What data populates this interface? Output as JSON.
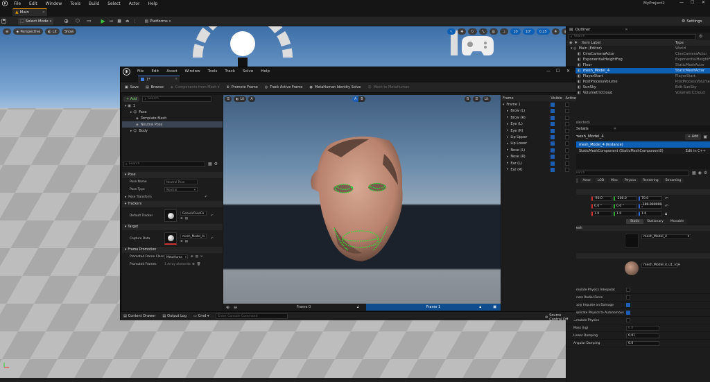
{
  "ue": {
    "menu": {
      "items": [
        "File",
        "Edit",
        "Window",
        "Tools",
        "Build",
        "Select",
        "Actor",
        "Help"
      ]
    },
    "project": "MyProject2",
    "main_tab": "Main",
    "toolbar": {
      "mode": "Select Mode",
      "platforms": "Platforms",
      "settings": "Settings"
    },
    "viewport": {
      "perspective": "Perspective",
      "lit": "Lit",
      "show": "Show",
      "fov": "10°",
      "scale": "0.25",
      "cam": "4",
      "grid": "10"
    }
  },
  "outliner": {
    "title": "Outliner",
    "search_placeholder": "Search",
    "col_label": "Item Label",
    "col_type": "Type",
    "rows": [
      {
        "label": "Main (Editor)",
        "type": "World",
        "indent": 0
      },
      {
        "label": "CineCameraActor",
        "type": "CineCameraActor",
        "indent": 1
      },
      {
        "label": "ExponentialHeightFog",
        "type": "ExponentialHeightFog",
        "indent": 1
      },
      {
        "label": "Floor",
        "type": "StaticMeshActor",
        "indent": 1
      },
      {
        "label": "mesh_Model_4",
        "type": "StaticMeshActor",
        "indent": 1,
        "selected": true
      },
      {
        "label": "PlayerStart",
        "type": "PlayerStart",
        "indent": 1
      },
      {
        "label": "PostProcessVolume",
        "type": "PostProcessVolume",
        "indent": 1
      },
      {
        "label": "SunSky",
        "type": "Edit SunSky",
        "indent": 1
      },
      {
        "label": "VolumetricCloud",
        "type": "VolumetricCloud",
        "indent": 1
      }
    ],
    "status": "(1 selected)"
  },
  "details": {
    "title": "Details",
    "actor": "mesh_Model_4",
    "add": "+ Add",
    "instance": "mesh_Model_4 (Instance)",
    "component": "StaticMeshComponent (StaticMeshComponent0)",
    "edit_in": "Edit in C++",
    "search_placeholder": "Search",
    "tabs": [
      "All",
      "Actor",
      "LOD",
      "Misc",
      "Physics",
      "Rendering",
      "Streaming"
    ],
    "loc": [
      "-90.0",
      "-200.0",
      "70.0"
    ],
    "rot": [
      "0.0 °",
      "0.0 °",
      "-189.999999 °"
    ],
    "scale": [
      "1.0",
      "1.0",
      "1.0"
    ],
    "mobility": [
      "Static",
      "Stationary",
      "Movable"
    ],
    "mesh_label": "Mesh",
    "mesh_value": "mesh_Model_4",
    "material_value": "mesh_Model_4_u1_v1",
    "props": [
      {
        "label": "Simulate Physics Interpolat",
        "type": "check",
        "on": false
      },
      {
        "label": "Ignore Radial Force",
        "type": "check",
        "on": false
      },
      {
        "label": "Apply Impulse on Damage",
        "type": "check",
        "on": true
      },
      {
        "label": "Replicate Physics to Autonomous",
        "type": "check",
        "on": true
      },
      {
        "label": "Simulate Physics",
        "type": "check",
        "on": false
      },
      {
        "label": "Mass (kg)",
        "type": "field",
        "value": "0.0",
        "dim": true
      },
      {
        "label": "Linear Damping",
        "type": "field",
        "value": "0.01"
      },
      {
        "label": "Angular Damping",
        "type": "field",
        "value": "0.0"
      }
    ]
  },
  "mh": {
    "menu": [
      "File",
      "Edit",
      "Asset",
      "Window",
      "Tools",
      "Track",
      "Solve",
      "Help"
    ],
    "tab": "1*",
    "toolbar": [
      {
        "label": "Save",
        "icon": "save-icon"
      },
      {
        "label": "Browse",
        "icon": "folder-icon"
      },
      {
        "label": "Components from Mesh ▾",
        "icon": "mesh-icon",
        "disabled": true
      },
      {
        "label": "Promote Frame",
        "icon": "plus-icon"
      },
      {
        "label": "Track Active Frame",
        "icon": "track-icon"
      },
      {
        "label": "MetaHuman Identity Solve",
        "icon": "solve-icon"
      },
      {
        "label": "Mesh to MetaHuman",
        "icon": "metahuman-icon",
        "disabled": true
      }
    ],
    "add": "+ Add",
    "search_placeholder": "Search",
    "tree": [
      {
        "label": "1",
        "indent": 0
      },
      {
        "label": "Face",
        "indent": 1
      },
      {
        "label": "Template Mesh",
        "indent": 2
      },
      {
        "label": "Neutral Pose",
        "indent": 2,
        "selected": true
      },
      {
        "label": "Body",
        "indent": 1
      }
    ],
    "pose_section": "Pose",
    "pose_name_label": "Pose Name",
    "pose_name": "Neutral Pose",
    "pose_type_label": "Pose Type",
    "pose_type": "Neutral",
    "pose_transform": "Pose Transform",
    "trackers_section": "Trackers",
    "default_tracker_label": "Default Tracker",
    "default_tracker": "GenericFaceCo",
    "target_section": "Target",
    "capture_label": "Capture Data",
    "capture_value": "mesh_Model_4",
    "frame_promo_section": "Frame Promotion",
    "promoted_class_label": "Promoted Frame Class",
    "promoted_class": "MetaHuma",
    "promoted_frames_label": "Promoted Frames",
    "promoted_frames": "1 Array elements",
    "vp_lit": "Lit",
    "vp_a": "A",
    "vp_ab_a": "A",
    "vp_ab_b": "B",
    "vp_b": "B",
    "frame0": "Frame 0",
    "frame1": "Frame 1",
    "tracker_header": [
      "Frame",
      "Visible",
      "Active"
    ],
    "trackers": [
      {
        "label": "Frame 1",
        "expanded": true
      },
      {
        "label": "Brow (L)",
        "indent": true
      },
      {
        "label": "Brow (R)",
        "indent": true
      },
      {
        "label": "Eye (L)",
        "indent": true
      },
      {
        "label": "Eye (R)",
        "indent": true
      },
      {
        "label": "Lip Upper",
        "indent": true
      },
      {
        "label": "Lip Lower",
        "indent": true
      },
      {
        "label": "Nose (L)",
        "indent": true
      },
      {
        "label": "Nose (R)",
        "indent": true
      },
      {
        "label": "Ear (L)",
        "indent": true
      },
      {
        "label": "Ear (R)",
        "indent": true
      }
    ],
    "status": {
      "content_drawer": "Content Drawer",
      "output_log": "Output Log",
      "cmd": "Cmd ▾",
      "console_placeholder": "Enter Console Command",
      "source_control": "Source Control Off"
    }
  },
  "colors": {
    "accent_blue": "#0d5fb3",
    "landmark_green": "#2ee03a",
    "ue_orange": "#d89000"
  }
}
